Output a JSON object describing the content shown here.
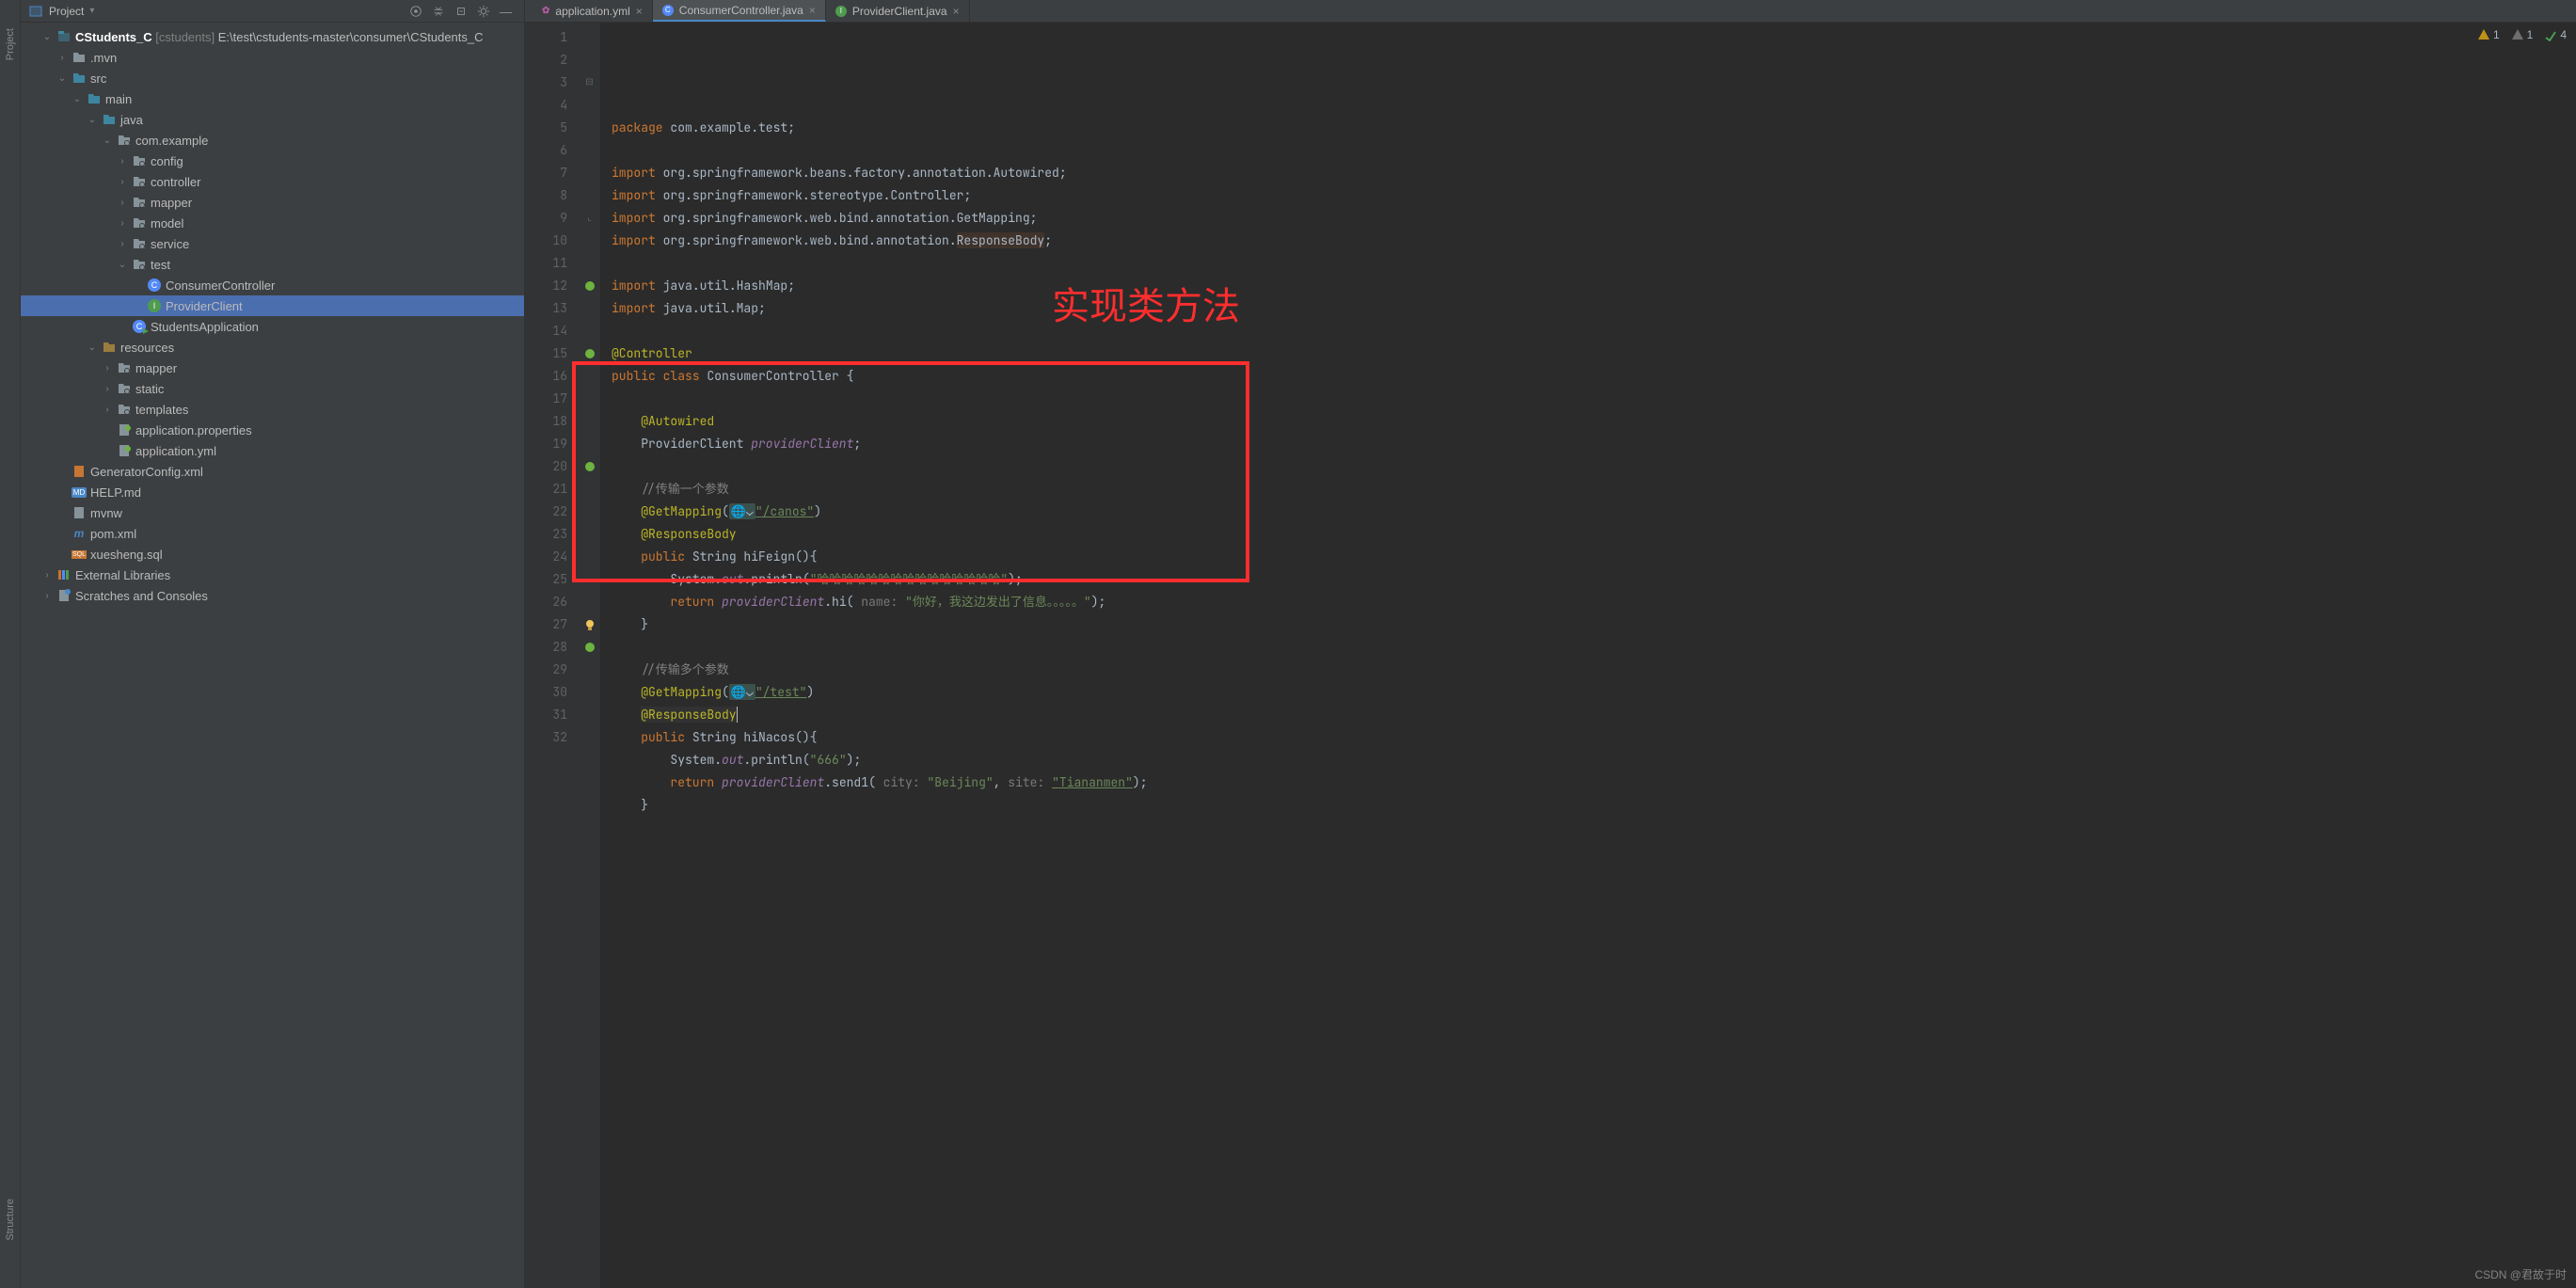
{
  "tool_strip": {
    "top": "Project",
    "bottom": "Structure"
  },
  "sidebar": {
    "title": "Project",
    "tree": [
      {
        "ind": 0,
        "chev": "v",
        "icon": "module",
        "html": "<strong>CStudents_C</strong> <em>[cstudents]</em>  E:\\test\\cstudents-master\\consumer\\CStudents_C"
      },
      {
        "ind": 1,
        "chev": ">",
        "icon": "folder",
        "label": ".mvn"
      },
      {
        "ind": 1,
        "chev": "v",
        "icon": "folder-src",
        "label": "src"
      },
      {
        "ind": 2,
        "chev": "v",
        "icon": "folder-src",
        "label": "main"
      },
      {
        "ind": 3,
        "chev": "v",
        "icon": "folder-src",
        "label": "java"
      },
      {
        "ind": 4,
        "chev": "v",
        "icon": "package",
        "label": "com.example"
      },
      {
        "ind": 5,
        "chev": ">",
        "icon": "package",
        "label": "config"
      },
      {
        "ind": 5,
        "chev": ">",
        "icon": "package",
        "label": "controller"
      },
      {
        "ind": 5,
        "chev": ">",
        "icon": "package",
        "label": "mapper"
      },
      {
        "ind": 5,
        "chev": ">",
        "icon": "package",
        "label": "model"
      },
      {
        "ind": 5,
        "chev": ">",
        "icon": "package",
        "label": "service"
      },
      {
        "ind": 5,
        "chev": "v",
        "icon": "package",
        "label": "test"
      },
      {
        "ind": 6,
        "chev": " ",
        "icon": "class",
        "label": "ConsumerController"
      },
      {
        "ind": 6,
        "chev": " ",
        "icon": "interface",
        "label": "ProviderClient",
        "selected": true
      },
      {
        "ind": 5,
        "chev": " ",
        "icon": "runclass",
        "label": "StudentsApplication"
      },
      {
        "ind": 3,
        "chev": "v",
        "icon": "folder-res",
        "label": "resources"
      },
      {
        "ind": 4,
        "chev": ">",
        "icon": "package",
        "label": "mapper"
      },
      {
        "ind": 4,
        "chev": ">",
        "icon": "package",
        "label": "static"
      },
      {
        "ind": 4,
        "chev": ">",
        "icon": "package",
        "label": "templates"
      },
      {
        "ind": 4,
        "chev": " ",
        "icon": "propfile",
        "label": "application.properties"
      },
      {
        "ind": 4,
        "chev": " ",
        "icon": "yml",
        "label": "application.yml"
      },
      {
        "ind": 1,
        "chev": " ",
        "icon": "xml",
        "label": "GeneratorConfig.xml"
      },
      {
        "ind": 1,
        "chev": " ",
        "icon": "md",
        "label": "HELP.md"
      },
      {
        "ind": 1,
        "chev": " ",
        "icon": "file",
        "label": "mvnw"
      },
      {
        "ind": 1,
        "chev": " ",
        "icon": "maven",
        "label": "pom.xml"
      },
      {
        "ind": 1,
        "chev": " ",
        "icon": "sql",
        "label": "xuesheng.sql"
      },
      {
        "ind": 0,
        "chev": ">",
        "icon": "libs",
        "label": "External Libraries"
      },
      {
        "ind": 0,
        "chev": ">",
        "icon": "scratches",
        "label": "Scratches and Consoles"
      }
    ]
  },
  "tabs": [
    {
      "icon": "yml",
      "label": "application.yml",
      "active": false
    },
    {
      "icon": "class",
      "label": "ConsumerController.java",
      "active": true
    },
    {
      "icon": "interface",
      "label": "ProviderClient.java",
      "active": false
    }
  ],
  "inspection": {
    "warn_y": "1",
    "warn_g": "1",
    "check": "4"
  },
  "annotation": {
    "text": "实现类方法"
  },
  "code": {
    "lines": [
      {
        "n": 1,
        "g": "",
        "html": "<span class='kw'>package</span> com.example.test;"
      },
      {
        "n": 2,
        "g": "",
        "html": " "
      },
      {
        "n": 3,
        "g": "fold",
        "html": "<span class='kw'>import</span> org.springframework.beans.factory.annotation.<span class='cls'>Autowired</span>;"
      },
      {
        "n": 4,
        "g": "",
        "html": "<span class='kw'>import</span> org.springframework.stereotype.<span class='cls'>Controller</span>;"
      },
      {
        "n": 5,
        "g": "",
        "html": "<span class='kw'>import</span> org.springframework.web.bind.annotation.<span class='cls'>GetMapping</span>;"
      },
      {
        "n": 6,
        "g": "",
        "html": "<span class='kw'>import</span> org.springframework.web.bind.annotation.<span class='cls' style='background:#40332b'>ResponseBody</span>;"
      },
      {
        "n": 7,
        "g": "",
        "html": " "
      },
      {
        "n": 8,
        "g": "",
        "html": "<span class='kw'>import</span> java.util.HashMap;"
      },
      {
        "n": 9,
        "g": "foldend",
        "html": "<span class='kw'>import</span> java.util.Map;"
      },
      {
        "n": 10,
        "g": "",
        "html": " "
      },
      {
        "n": 11,
        "g": "",
        "html": "<span class='ann'>@Controller</span>"
      },
      {
        "n": 12,
        "g": "spring",
        "html": "<span class='kw'>public class</span> ConsumerController {"
      },
      {
        "n": 13,
        "g": "",
        "html": " "
      },
      {
        "n": 14,
        "g": "",
        "html": "    <span class='ann'>@Autowired</span>"
      },
      {
        "n": 15,
        "g": "spring",
        "html": "    ProviderClient <span class='field-static'>providerClient</span>;"
      },
      {
        "n": 16,
        "g": "",
        "html": " "
      },
      {
        "n": 17,
        "g": "",
        "html": "    <span class='comm'>//传输一个参数</span>"
      },
      {
        "n": 18,
        "g": "",
        "html": "    <span class='ann'>@GetMapping</span>(<span class='weblink'>🌐⌄</span><span class='str underline'>\"/canos\"</span>)"
      },
      {
        "n": 19,
        "g": "",
        "html": "    <span class='ann'>@ResponseBody</span>"
      },
      {
        "n": 20,
        "g": "spring",
        "html": "    <span class='kw'>public</span> String hiFeign(){"
      },
      {
        "n": 21,
        "g": "",
        "html": "        System.<span class='field-static'>out</span>.println(<span class='str'>\"哈哈哈哈哈哈哈哈哈哈哈哈哈哈哈\"</span>);"
      },
      {
        "n": 22,
        "g": "",
        "html": "        <span class='kw'>return</span> <span class='field-static'>providerClient</span>.hi( <span class='param-hint'>name:</span> <span class='str'>\"你好，我这边发出了信息。。。。。\"</span>);"
      },
      {
        "n": 23,
        "g": "",
        "html": "    }"
      },
      {
        "n": 24,
        "g": "",
        "html": " "
      },
      {
        "n": 25,
        "g": "",
        "html": "    <span class='comm'>//传输多个参数</span>"
      },
      {
        "n": 26,
        "g": "",
        "html": "    <span class='ann'>@GetMapping</span>(<span class='weblink'>🌐⌄</span><span class='str underline'>\"/test\"</span>)"
      },
      {
        "n": 27,
        "g": "bulb",
        "html": "    <span class='ann' style='background:#323232'>@ResponseBody</span><span class='caret'></span>"
      },
      {
        "n": 28,
        "g": "spring",
        "html": "    <span class='kw'>public</span> String hiNacos(){"
      },
      {
        "n": 29,
        "g": "",
        "html": "        System.<span class='field-static'>out</span>.println(<span class='str'>\"666\"</span>);"
      },
      {
        "n": 30,
        "g": "",
        "html": "        <span class='kw'>return</span> <span class='field-static'>providerClient</span>.send1( <span class='param-hint'>city:</span> <span class='str'>\"Beijing\"</span>, <span class='param-hint'>site:</span> <span class='str underline'>\"Tiananmen\"</span>);"
      },
      {
        "n": 31,
        "g": "",
        "html": "    }"
      },
      {
        "n": 32,
        "g": "",
        "html": " "
      }
    ]
  },
  "watermark": "CSDN @君故于时"
}
